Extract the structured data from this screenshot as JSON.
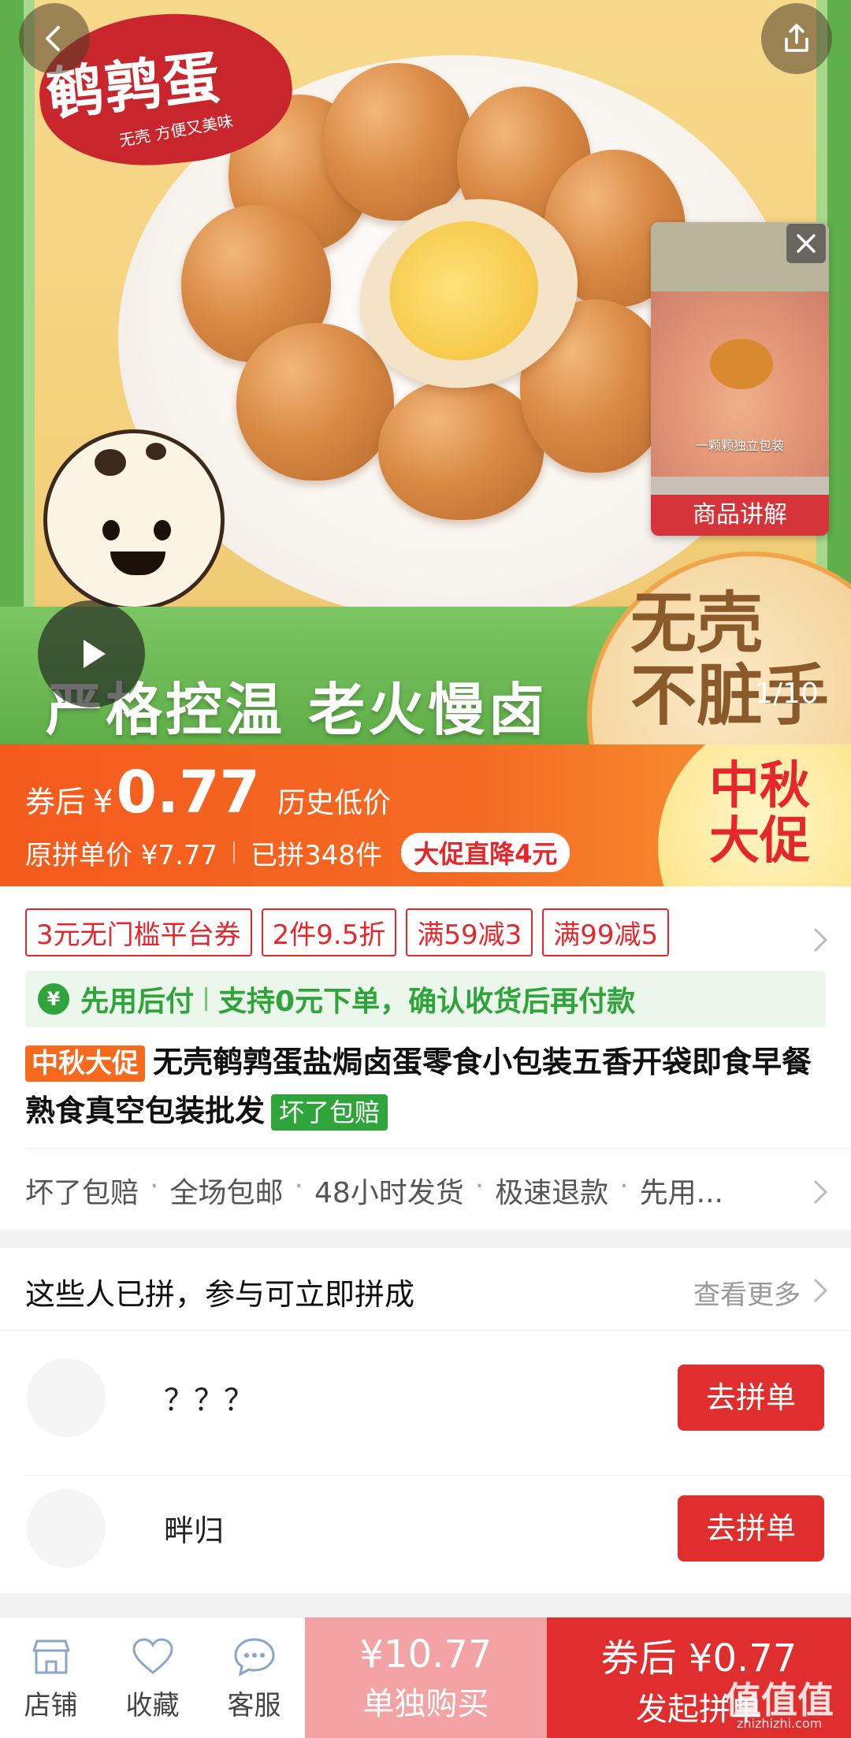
{
  "hero": {
    "brand_logo_text": "鹌鹑蛋",
    "brand_logo_sub": "无壳 方便又美味",
    "slogan": "严格控温 老火慢卤",
    "badge_line1": "无壳",
    "badge_line2": "不脏手",
    "image_counter": "1/10",
    "video_card": {
      "caption": "一颗颗独立包装",
      "label": "商品讲解"
    }
  },
  "price": {
    "prefix": "券后",
    "symbol": "¥",
    "value": "0.77",
    "note": "历史低价",
    "original": "原拼单价 ¥7.77",
    "sold": "已拼348件",
    "drop_tag": "大促直降4元",
    "promo_line1": "中秋",
    "promo_line2": "大促"
  },
  "coupons": [
    "3元无门槛平台券",
    "2件9.5折",
    "满59减3",
    "满99减5"
  ],
  "pay_later": {
    "title": "先用后付",
    "desc": "支持0元下单，确认收货后再付款"
  },
  "product": {
    "tag": "中秋大促",
    "title": "无壳鹌鹑蛋盐焗卤蛋零食小包装五香开袋即食早餐熟食真空包装批发",
    "badge": "坏了包赔"
  },
  "services": [
    "坏了包赔",
    "全场包邮",
    "48小时发货",
    "极速退款",
    "先用..."
  ],
  "group_buy": {
    "title": "这些人已拼，参与可立即拼成",
    "more": "查看更多",
    "rows": [
      {
        "name": "？？？",
        "button": "去拼单"
      },
      {
        "name": "畔归",
        "button": "去拼单"
      }
    ]
  },
  "bottom_bar": {
    "tabs": [
      {
        "label": "店铺",
        "icon": "shop-icon"
      },
      {
        "label": "收藏",
        "icon": "heart-icon"
      },
      {
        "label": "客服",
        "icon": "chat-icon"
      }
    ],
    "buy_alone_price": "¥10.77",
    "buy_alone_label": "单独购买",
    "buy_group_price": "券后 ¥0.77",
    "buy_group_label": "发起拼单"
  },
  "watermark": {
    "main": "值值值",
    "sub": "zhizhizhi.com"
  }
}
